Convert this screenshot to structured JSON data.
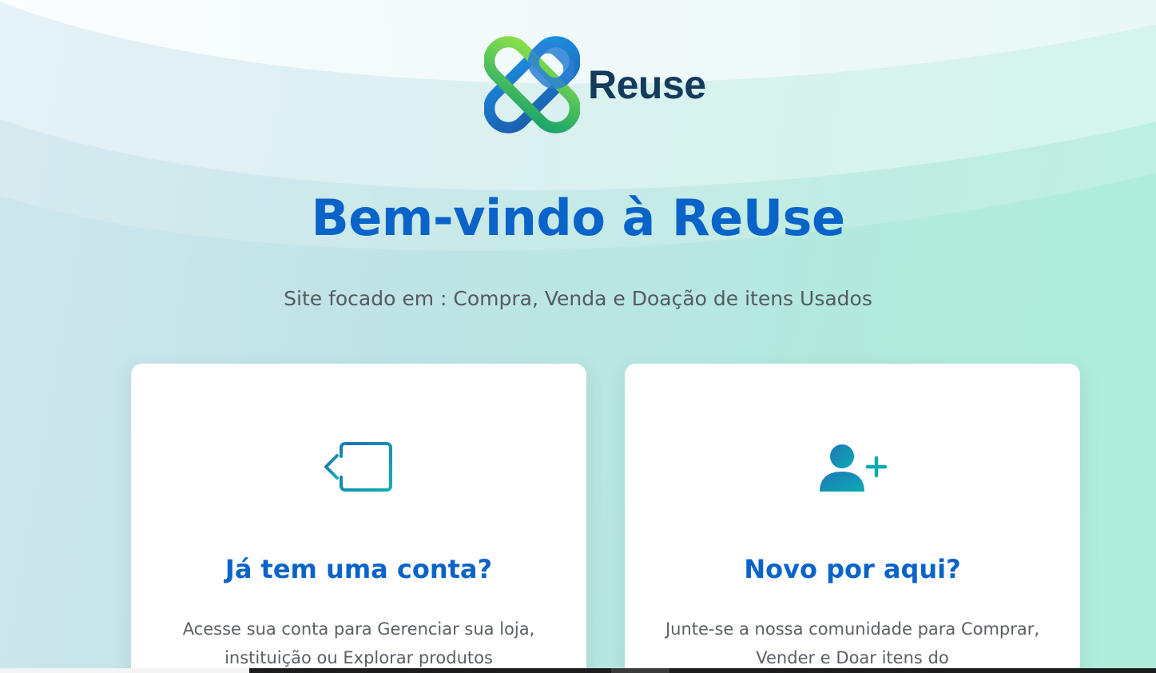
{
  "brand": {
    "name": "Reuse"
  },
  "hero": {
    "title": "Bem-vindo à ReUse",
    "subtitle": "Site focado em : Compra, Venda e Doação de itens Usados"
  },
  "cards": {
    "login": {
      "icon": "login-arrow-icon",
      "title": "Já tem uma conta?",
      "description": "Acesse sua conta para Gerenciar sua loja, instituição ou Explorar produtos"
    },
    "register": {
      "icon": "user-add-icon",
      "title": "Novo por aqui?",
      "description": "Junte-se a nossa comunidade para Comprar, Vender e Doar itens do"
    }
  },
  "colors": {
    "primary": "#0a63c9",
    "icon_teal": "#0aa3b3",
    "logo_text": "#143a5c"
  }
}
